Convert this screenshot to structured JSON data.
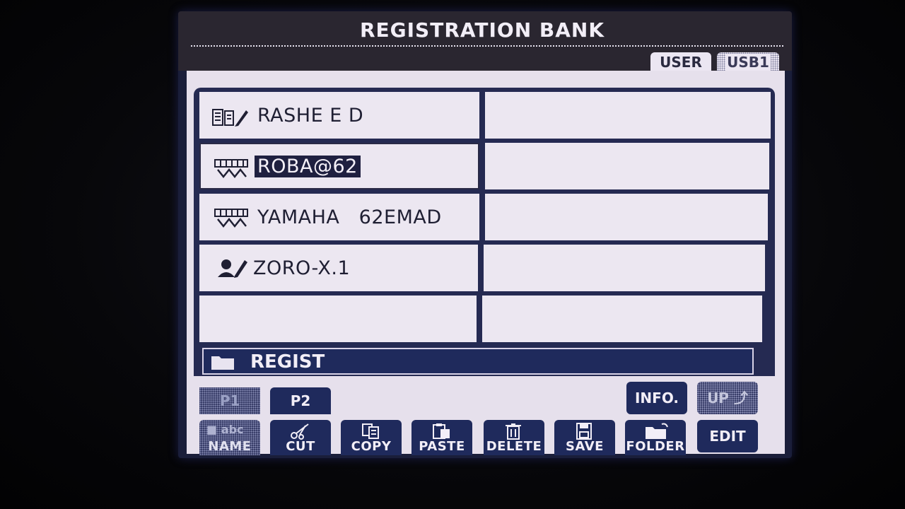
{
  "header": {
    "title": "REGISTRATION BANK",
    "tabs": [
      {
        "label": "USER",
        "active": true
      },
      {
        "label": "USB1",
        "active": false
      }
    ]
  },
  "files": [
    {
      "name": "RASHE E D",
      "icon": "registration-edit-icon",
      "selected": false
    },
    {
      "name": "ROBA@62",
      "icon": "registration-keyboard-icon",
      "selected": true
    },
    {
      "name": "YAMAHA   62EMAD",
      "icon": "registration-keyboard-icon",
      "selected": false
    },
    {
      "name": "ZORO-X.1",
      "icon": "registration-user-icon",
      "selected": false
    }
  ],
  "folder": {
    "label": "REGIST",
    "icon": "folder-icon"
  },
  "pages": [
    {
      "label": "P1",
      "active": false
    },
    {
      "label": "P2",
      "active": true
    }
  ],
  "function_buttons": [
    {
      "label": "NAME",
      "sub": "abc",
      "icon": "name-icon",
      "enabled": false
    },
    {
      "label": "CUT",
      "icon": "scissors-icon",
      "enabled": true
    },
    {
      "label": "COPY",
      "icon": "copy-icon",
      "enabled": true
    },
    {
      "label": "PASTE",
      "icon": "paste-icon",
      "enabled": true
    },
    {
      "label": "DELETE",
      "icon": "trash-icon",
      "enabled": true
    },
    {
      "label": "SAVE",
      "icon": "floppy-icon",
      "enabled": true
    },
    {
      "label": "FOLDER",
      "icon": "new-folder-icon",
      "enabled": true
    }
  ],
  "right_buttons": {
    "info": {
      "label": "INFO.",
      "enabled": true
    },
    "up": {
      "label": "UP",
      "enabled": false
    },
    "edit": {
      "label": "EDIT",
      "enabled": true
    }
  },
  "colors": {
    "lcd_background": "#e6e0ec",
    "lcd_dark": "#1f2a5c",
    "text": "#1f1f33"
  }
}
